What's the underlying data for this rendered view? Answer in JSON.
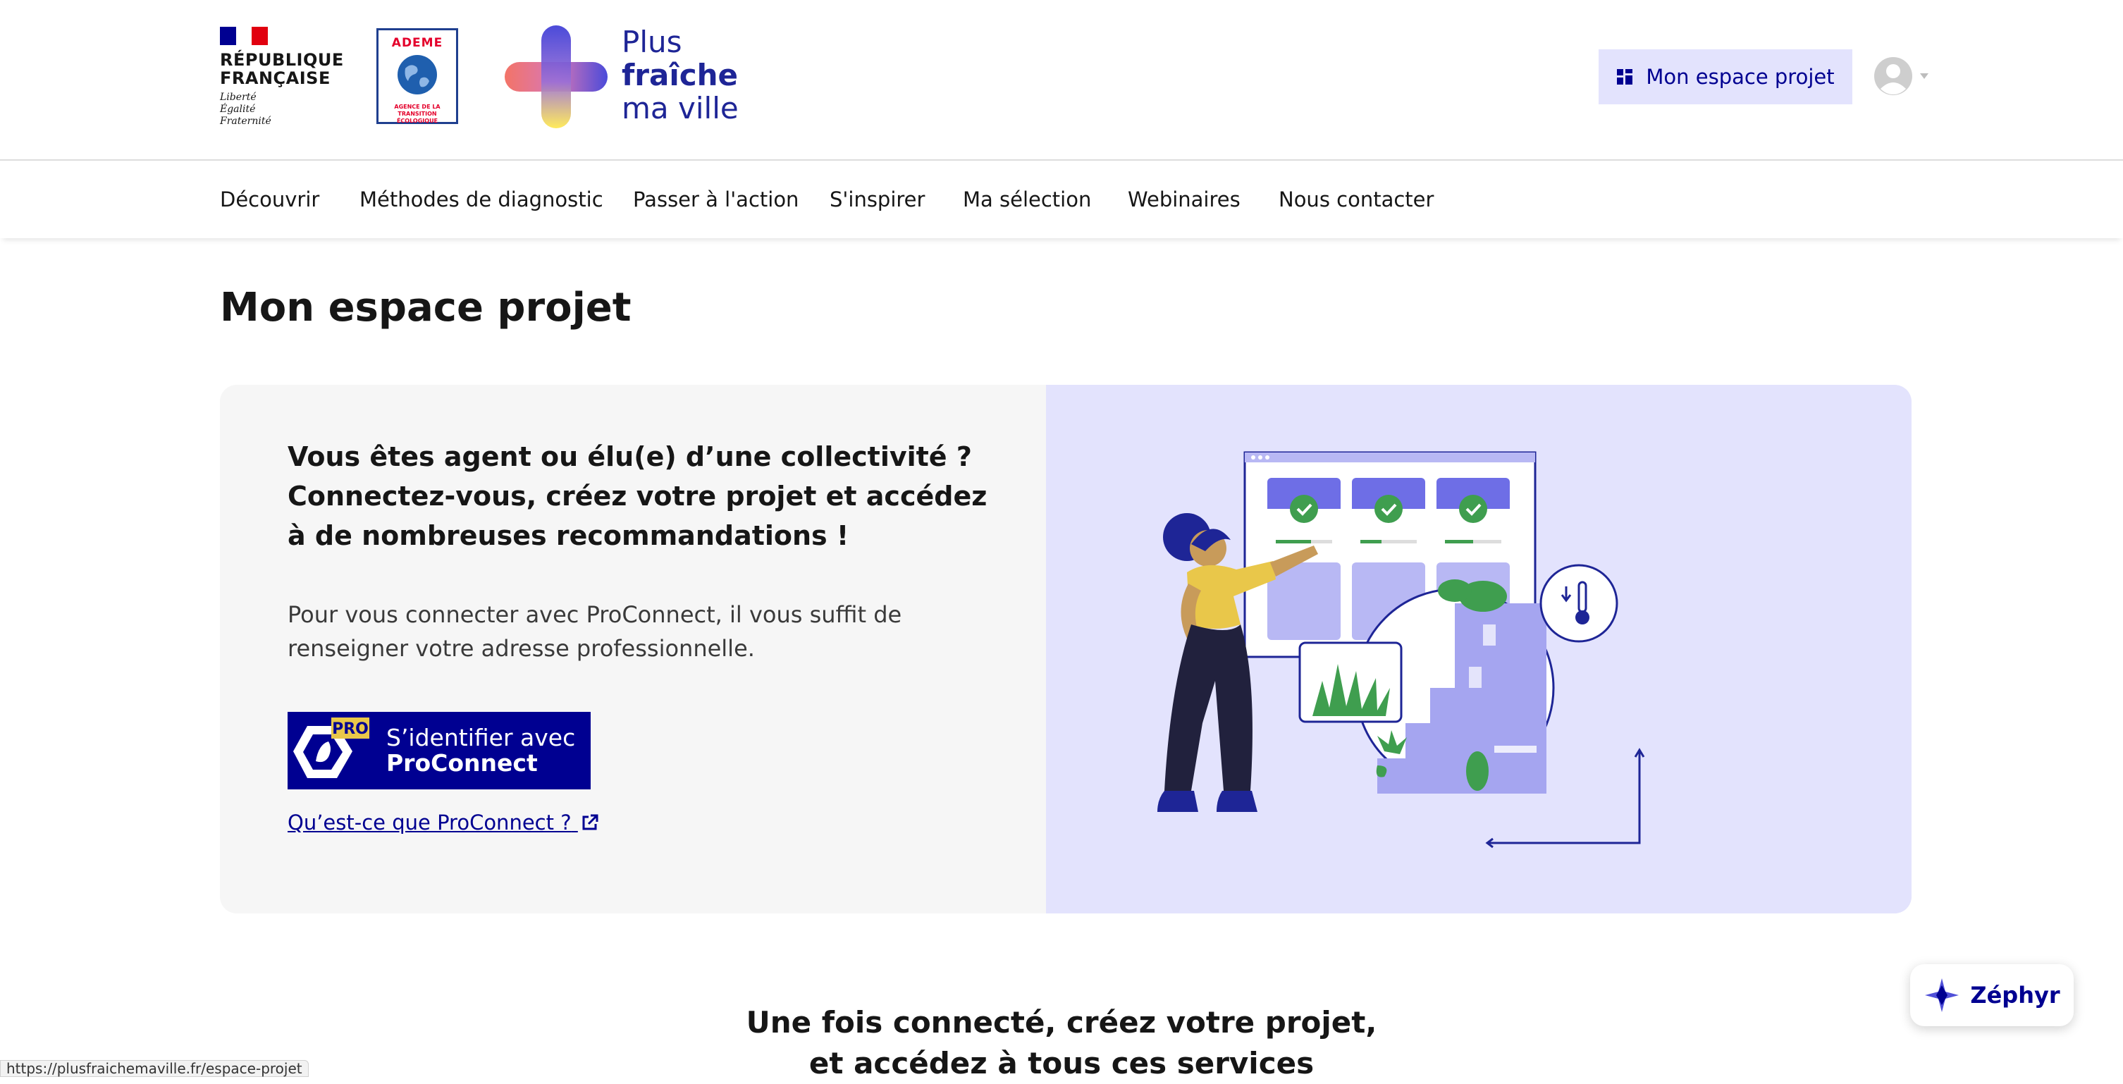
{
  "header": {
    "republique": {
      "title_line1": "RÉPUBLIQUE",
      "title_line2": "FRANÇAISE",
      "motto1": "Liberté",
      "motto2": "Égalité",
      "motto3": "Fraternité"
    },
    "ademe": {
      "name": "ADEME",
      "subtitle1": "AGENCE DE LA",
      "subtitle2": "TRANSITION",
      "subtitle3": "ÉCOLOGIQUE"
    },
    "brand": {
      "line1": "Plus",
      "line2": "fraîche",
      "line3": "ma ville"
    },
    "espace_button": "Mon espace projet",
    "user_icon": "user-avatar-icon"
  },
  "nav": {
    "items": [
      {
        "label": "Découvrir"
      },
      {
        "label": "Méthodes de diagnostic"
      },
      {
        "label": "Passer à l'action"
      },
      {
        "label": "S'inspirer"
      },
      {
        "label": "Ma sélection"
      },
      {
        "label": "Webinaires"
      },
      {
        "label": "Nous contacter"
      }
    ]
  },
  "main": {
    "title": "Mon espace projet",
    "card": {
      "heading": "Vous êtes agent ou élu(e) d’une collectivité ? Connectez-vous, créez votre projet et accédez à de nombreuses recommandations !",
      "text": "Pour vous connecter avec ProConnect, il vous suffit de renseigner votre adresse professionnelle.",
      "proconnect_badge": "PRO",
      "proconnect_line1": "S’identifier avec",
      "proconnect_line2": "ProConnect",
      "link": "Qu’est-ce que ProConnect ?"
    },
    "services_line1": "Une fois connecté, créez votre projet,",
    "services_line2": "et accédez à tous ces services"
  },
  "zephyr": {
    "label": "Zéphyr"
  },
  "status_bar": {
    "url": "https://plusfraichemaville.fr/espace-projet"
  },
  "colors": {
    "primary": "#000091",
    "accent_light": "#e3e3fd",
    "card_bg": "#f6f6f6",
    "illustration_purple": "#6e6ee6",
    "illustration_green": "#3f9e4f",
    "shirt_yellow": "#e9c74a"
  }
}
